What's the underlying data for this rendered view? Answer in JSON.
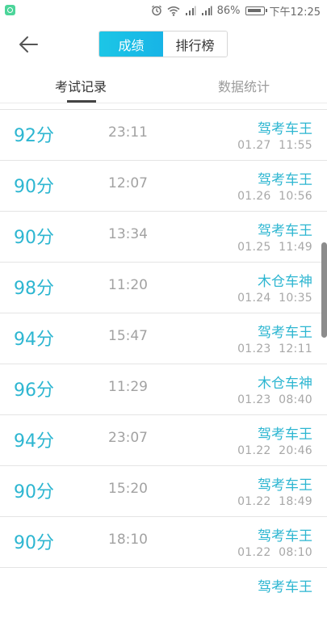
{
  "status": {
    "battery": "86%",
    "time": "下午12:25"
  },
  "header": {
    "seg_active": "成绩",
    "seg_inactive": "排行榜"
  },
  "tabs": {
    "records": "考试记录",
    "stats": "数据统计"
  },
  "records": [
    {
      "score": "92分",
      "duration": "23:11",
      "title": "驾考车王",
      "date": "01.27  11:55"
    },
    {
      "score": "90分",
      "duration": "12:07",
      "title": "驾考车王",
      "date": "01.26  10:56"
    },
    {
      "score": "90分",
      "duration": "13:34",
      "title": "驾考车王",
      "date": "01.25  11:49"
    },
    {
      "score": "98分",
      "duration": "11:20",
      "title": "木仓车神",
      "date": "01.24  10:35"
    },
    {
      "score": "94分",
      "duration": "15:47",
      "title": "驾考车王",
      "date": "01.23  12:11"
    },
    {
      "score": "96分",
      "duration": "11:29",
      "title": "木仓车神",
      "date": "01.23  08:40"
    },
    {
      "score": "94分",
      "duration": "23:07",
      "title": "驾考车王",
      "date": "01.22  20:46"
    },
    {
      "score": "90分",
      "duration": "15:20",
      "title": "驾考车王",
      "date": "01.22  18:49"
    },
    {
      "score": "90分",
      "duration": "18:10",
      "title": "驾考车王",
      "date": "01.22  08:10"
    },
    {
      "score": "",
      "duration": "",
      "title": "驾考车王",
      "date": ""
    }
  ]
}
